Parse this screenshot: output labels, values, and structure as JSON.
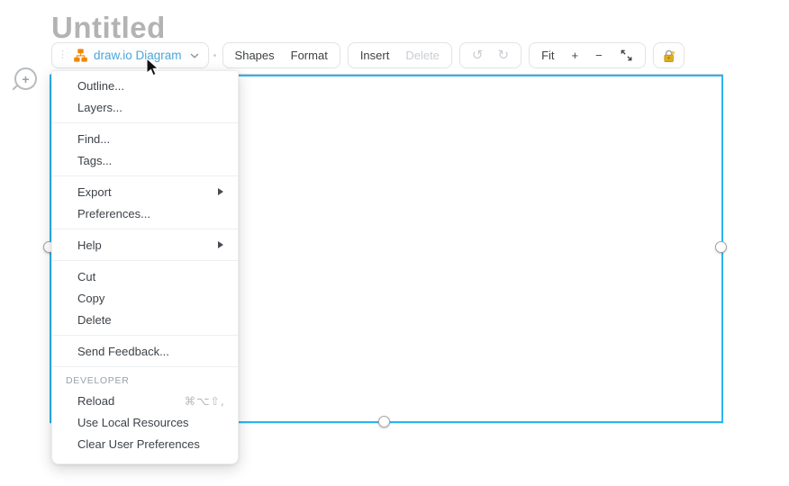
{
  "title": "Untitled",
  "toolbar": {
    "diagram_button": "draw.io Diagram",
    "shapes": "Shapes",
    "format": "Format",
    "insert": "Insert",
    "delete": "Delete",
    "fit": "Fit",
    "zoom_in": "+",
    "zoom_out": "−"
  },
  "canvas": {
    "zoom_badge": "+"
  },
  "menu": {
    "groups": [
      {
        "items": [
          {
            "label": "Outline..."
          },
          {
            "label": "Layers..."
          }
        ]
      },
      {
        "items": [
          {
            "label": "Find..."
          },
          {
            "label": "Tags..."
          }
        ]
      },
      {
        "items": [
          {
            "label": "Export",
            "submenu": true
          },
          {
            "label": "Preferences..."
          }
        ]
      },
      {
        "items": [
          {
            "label": "Help",
            "submenu": true
          }
        ]
      },
      {
        "items": [
          {
            "label": "Cut"
          },
          {
            "label": "Copy"
          },
          {
            "label": "Delete"
          }
        ]
      },
      {
        "items": [
          {
            "label": "Send Feedback..."
          }
        ]
      },
      {
        "header": "DEVELOPER",
        "items": [
          {
            "label": "Reload",
            "shortcut": "⌘⌥⇧,"
          },
          {
            "label": "Use Local Resources"
          },
          {
            "label": "Clear User Preferences"
          }
        ]
      }
    ]
  },
  "icons": {
    "undo": "↺",
    "redo": "↻"
  },
  "colors": {
    "selection_blue": "#29b6f2",
    "brand_blue": "#4aa5d9",
    "logo_orange": "#f08705",
    "lock_gold": "#e3ac1e"
  }
}
